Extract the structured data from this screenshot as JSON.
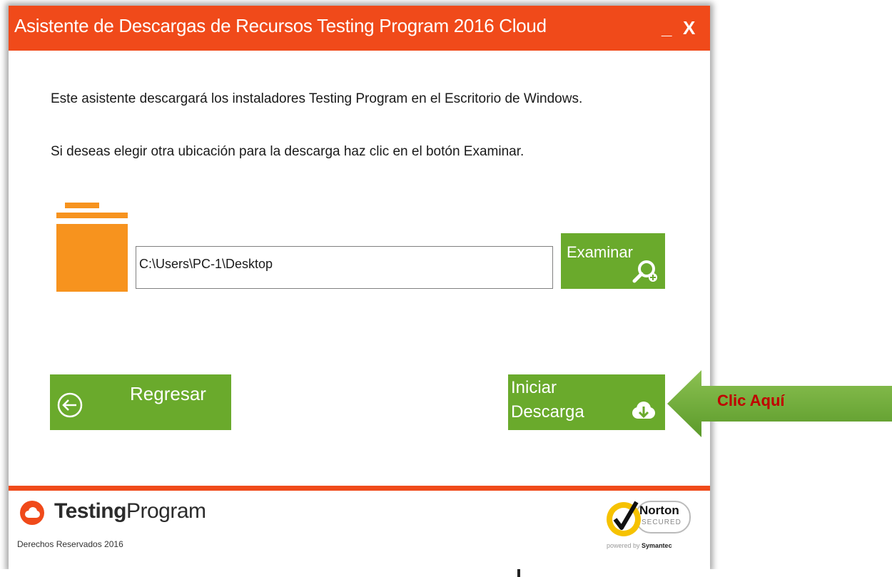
{
  "window": {
    "title": "Asistente de Descargas de Recursos Testing Program 2016 Cloud",
    "minimize_label": "_",
    "close_label": "X"
  },
  "content": {
    "message1": "Este asistente descargará los instaladores Testing Program en el Escritorio de Windows.",
    "message2": "Si deseas elegir otra ubicación para la descarga haz clic en el botón Examinar.",
    "path_value": "C:\\Users\\PC-1\\Desktop",
    "browse_label": "Examinar",
    "back_label": "Regresar",
    "download_label_line1": "Iniciar",
    "download_label_line2": "Descarga"
  },
  "footer": {
    "brand_bold": "Testing",
    "brand_light": "Program",
    "copyright": "Derechos Reservados 2016",
    "norton_name": "Norton",
    "norton_secured": "SECURED",
    "norton_powered": "powered by",
    "norton_vendor": "Symantec"
  },
  "annotation": {
    "callout": "Clic Aquí"
  },
  "colors": {
    "accent_orange": "#f04a1a",
    "button_green": "#6aaa2c",
    "folder_orange": "#f7931e",
    "callout_arrow": "#6aaa2c",
    "callout_text": "#c00000"
  },
  "icons": [
    "folder-icon",
    "search-plus-icon",
    "back-arrow-icon",
    "cloud-download-icon",
    "testingprogram-logo-icon",
    "norton-check-icon"
  ]
}
